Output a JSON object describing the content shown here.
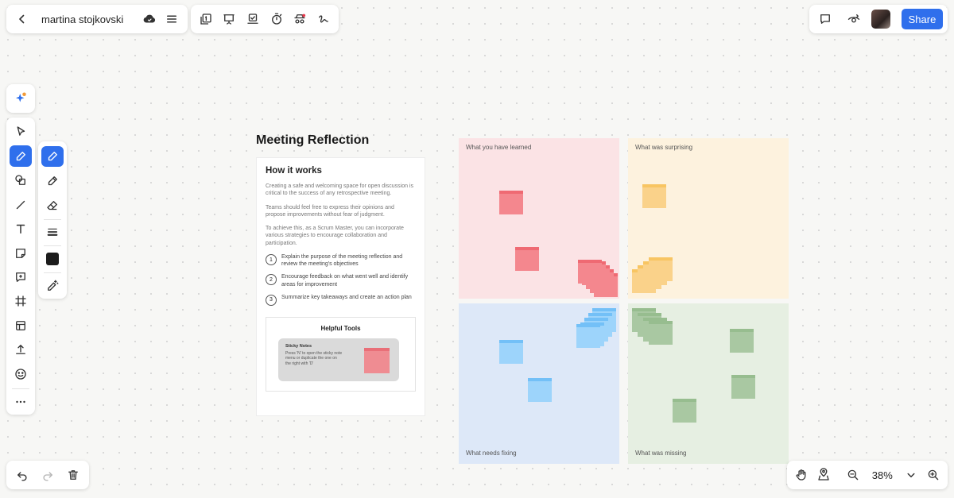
{
  "board": {
    "name": "martina stojkovski"
  },
  "header": {
    "share_label": "Share"
  },
  "zoom": {
    "level": "38%"
  },
  "frame": {
    "title": "Meeting Reflection",
    "card_title": "How it works",
    "paragraphs": [
      "Creating a safe and welcoming space for open discussion is critical to the success of any retrospective meeting.",
      "Teams should feel free to express their opinions and propose improvements without fear of judgment.",
      "To achieve this, as a Scrum Master, you can incorporate various strategies to encourage collaboration and participation."
    ],
    "steps": [
      {
        "num": "1",
        "text": "Explain the purpose of the meeting reflection and review the meeting's objectives"
      },
      {
        "num": "2",
        "text": "Encourage feedback on what went well and identify areas for improvement"
      },
      {
        "num": "3",
        "text": "Summarize key takeaways and create an action plan"
      }
    ],
    "helpful_title": "Helpful Tools",
    "tip_title": "Sticky Notes",
    "tip_text": "Press 'N' to open the sticky note menu or duplicate the one on the right with 'D'"
  },
  "quadrants": {
    "learned": "What you have learned",
    "surprising": "What was surprising",
    "fixing": "What needs fixing",
    "missing": "What was missing"
  },
  "colors": {
    "accent": "#2f6fec",
    "note_red": "#f4878e",
    "note_yellow": "#fad28a",
    "note_blue": "#9dd4fb",
    "note_green": "#a9c8a2"
  },
  "icons": {
    "top_left": [
      "back-icon",
      "cloud-sync-icon",
      "menu-icon"
    ],
    "top_tools": [
      "pages-icon",
      "present-icon",
      "board-view-icon",
      "timer-icon",
      "collaborators-icon",
      "signature-icon"
    ],
    "top_right": [
      "comment-icon",
      "eye-icon"
    ],
    "left_tools": [
      "select-icon",
      "pen-icon",
      "shapes-icon",
      "line-icon",
      "text-icon",
      "sticky-note-icon",
      "comment-icon",
      "frame-icon",
      "template-icon",
      "upload-icon",
      "emoji-icon",
      "more-icon"
    ],
    "pen_tools": [
      "pen-icon",
      "marker-icon",
      "eraser-icon",
      "stroke-width-icon",
      "color-swatch",
      "magic-pen-icon"
    ],
    "bottom": [
      "undo-icon",
      "redo-icon",
      "trash-icon",
      "hand-icon",
      "map-icon",
      "zoom-out-icon",
      "chevron-down-icon",
      "zoom-in-icon"
    ]
  }
}
